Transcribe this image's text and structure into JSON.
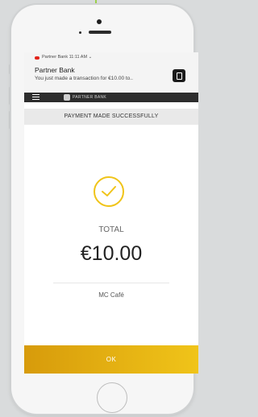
{
  "notification": {
    "app_name": "Partner Bank",
    "time": "11:11 AM",
    "expand_glyph": "⌄",
    "title": "Partner Bank",
    "message": "You just made a transaction for €10.00 to..",
    "accent_color": "#e2231a",
    "icon": "partner-bank-app-icon"
  },
  "app_bar": {
    "menu_icon": "menu-icon",
    "brand_text": "PARTNER BANK",
    "background": "#2d2d2d"
  },
  "payment": {
    "header": "PAYMENT MADE SUCCESSFULLY",
    "status_icon": "checkmark-icon",
    "total_label": "TOTAL",
    "amount": "€10.00",
    "merchant": "MC Café",
    "accent_color": "#f0c419"
  },
  "actions": {
    "ok_label": "OK"
  }
}
